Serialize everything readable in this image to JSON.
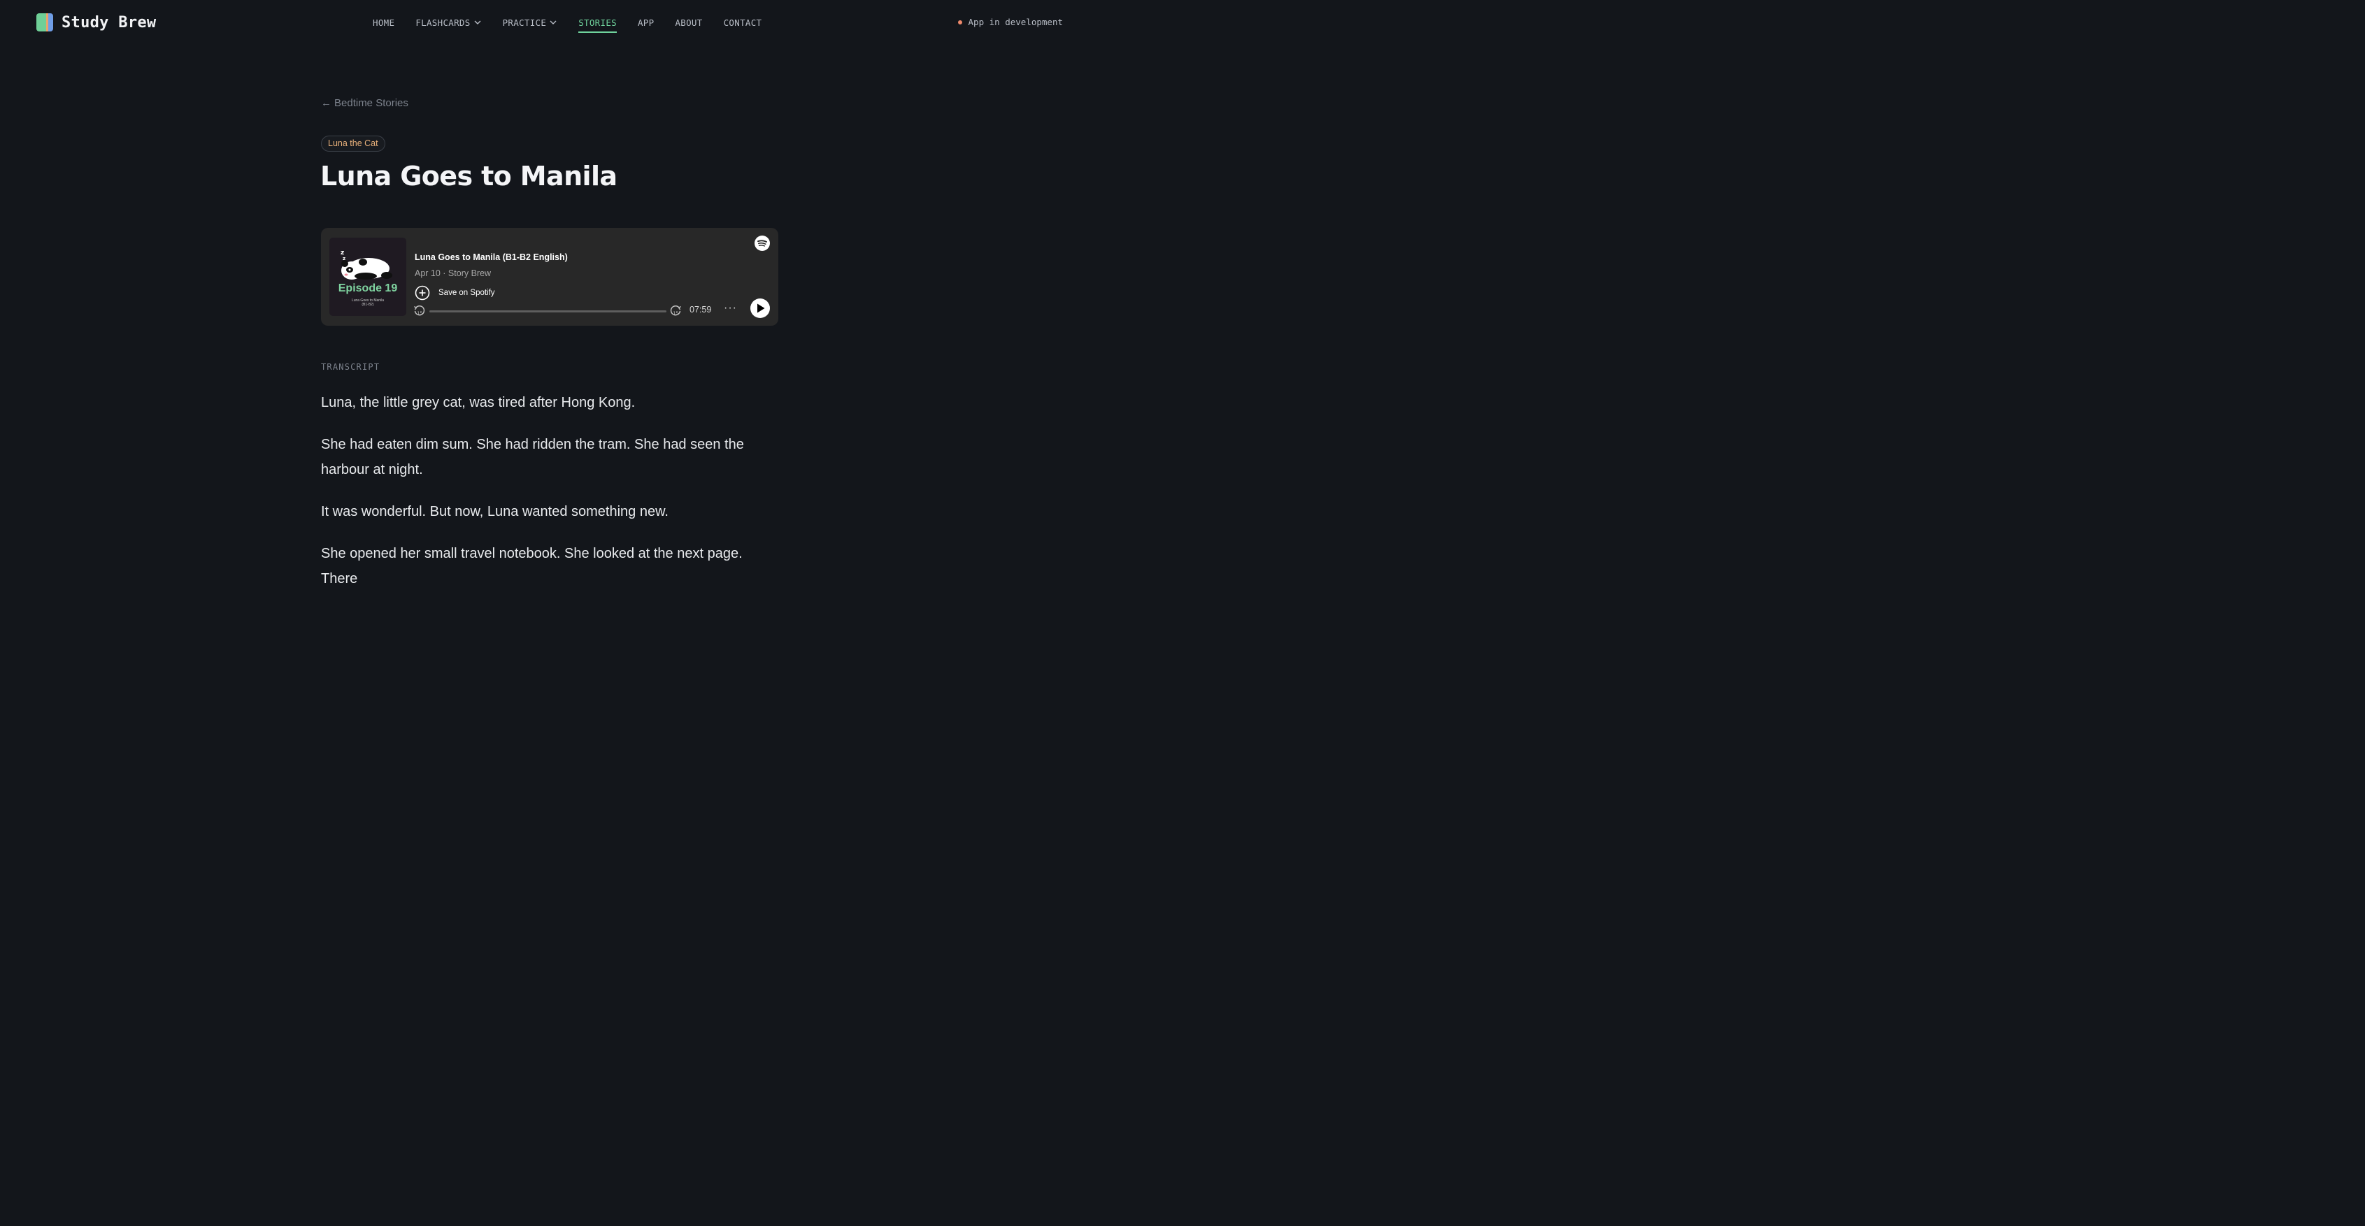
{
  "brand": {
    "name": "Study Brew"
  },
  "nav": {
    "items": [
      {
        "label": "HOME",
        "dropdown": false,
        "active": false
      },
      {
        "label": "FLASHCARDS",
        "dropdown": true,
        "active": false
      },
      {
        "label": "PRACTICE",
        "dropdown": true,
        "active": false
      },
      {
        "label": "STORIES",
        "dropdown": false,
        "active": true
      },
      {
        "label": "APP",
        "dropdown": false,
        "active": false
      },
      {
        "label": "ABOUT",
        "dropdown": false,
        "active": false
      },
      {
        "label": "CONTACT",
        "dropdown": false,
        "active": false
      }
    ]
  },
  "status": {
    "text": "App in development",
    "dot_color": "#ef8a6c"
  },
  "back_link": {
    "arrow": "←",
    "label": "Bedtime Stories"
  },
  "series_badge": "Luna the Cat",
  "page_title": "Luna Goes to Manila",
  "player": {
    "cover_episode": "Episode 19",
    "cover_subtitle_line1": "Luna Goes to Manila",
    "cover_subtitle_line2": "(B1-B2)",
    "episode_title": "Luna Goes to Manila (B1-B2 English)",
    "meta": "Apr 10 · Story Brew",
    "save_label": "Save on Spotify",
    "duration": "07:59",
    "more": "···",
    "progress": 0,
    "skip_back_seconds": "15",
    "skip_forward_seconds": "15"
  },
  "transcript": {
    "label": "TRANSCRIPT",
    "paragraphs": [
      "Luna, the little grey cat, was tired after Hong Kong.",
      "She had eaten dim sum. She had ridden the tram. She had seen the harbour at night.",
      "It was wonderful. But now, Luna wanted something new.",
      "She opened her small travel notebook. She looked at the next page. There"
    ]
  },
  "colors": {
    "accent": "#6fd29c",
    "badge_text": "#e8b07a",
    "background": "#13161b",
    "player_bg": "#282828"
  }
}
